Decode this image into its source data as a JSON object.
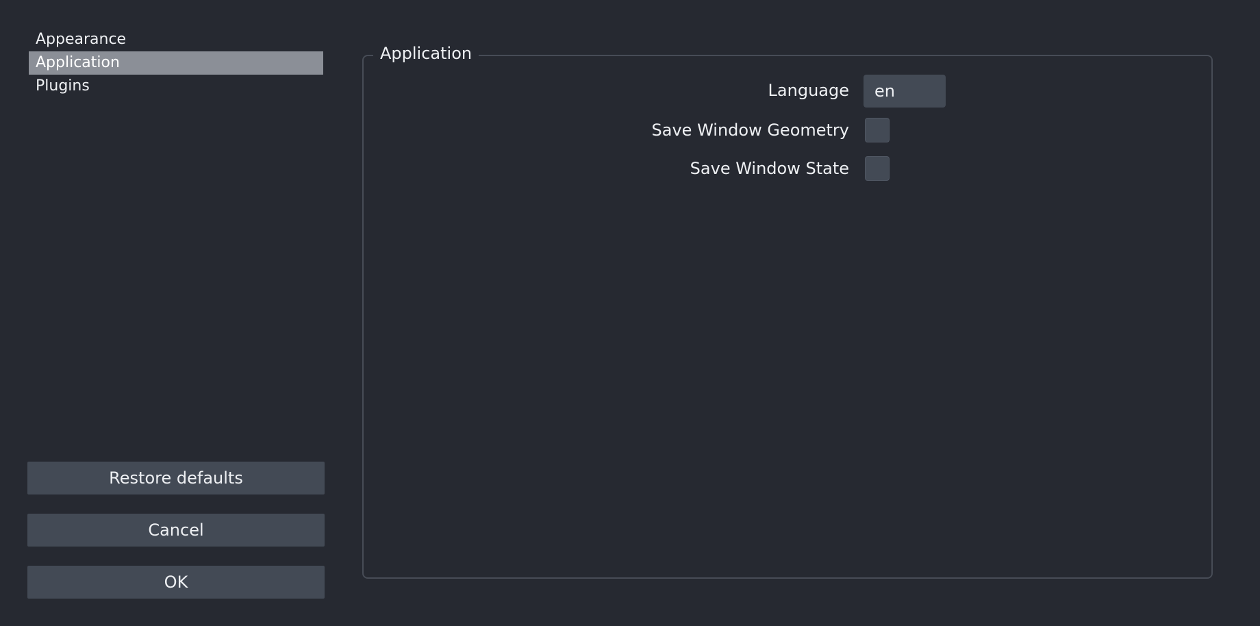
{
  "nav": {
    "items": [
      {
        "label": "Appearance",
        "selected": false
      },
      {
        "label": "Application",
        "selected": true
      },
      {
        "label": "Plugins",
        "selected": false
      }
    ]
  },
  "buttons": {
    "restore_label": "Restore defaults",
    "cancel_label": "Cancel",
    "ok_label": "OK"
  },
  "group": {
    "title": "Application",
    "language": {
      "label": "Language",
      "value": "en"
    },
    "save_window_geometry": {
      "label": "Save Window Geometry",
      "checked": false
    },
    "save_window_state": {
      "label": "Save Window State",
      "checked": false
    }
  },
  "colors": {
    "background": "#262931",
    "control": "#434a55",
    "selection": "#8b8f97",
    "border": "#474c56",
    "text": "#eef0f3"
  }
}
